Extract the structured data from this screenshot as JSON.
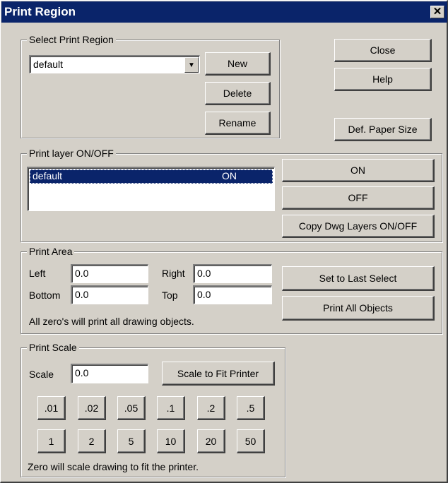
{
  "window": {
    "title": "Print Region",
    "close_glyph": "✕"
  },
  "select_region": {
    "legend": "Select Print Region",
    "selected": "default",
    "new_label": "New",
    "delete_label": "Delete",
    "rename_label": "Rename"
  },
  "side_buttons": {
    "close_label": "Close",
    "help_label": "Help",
    "paper_label": "Def. Paper Size"
  },
  "layers": {
    "legend": "Print layer ON/OFF",
    "rows": [
      {
        "name": "default",
        "state": "ON"
      }
    ],
    "on_label": "ON",
    "off_label": "OFF",
    "copy_label": "Copy Dwg Layers ON/OFF"
  },
  "area": {
    "legend": "Print Area",
    "left_label": "Left",
    "left_value": "0.0",
    "right_label": "Right",
    "right_value": "0.0",
    "bottom_label": "Bottom",
    "bottom_value": "0.0",
    "top_label": "Top",
    "top_value": "0.0",
    "note": "All zero's will print all drawing objects.",
    "set_last_label": "Set to Last Select",
    "print_all_label": "Print All Objects"
  },
  "scale": {
    "legend": "Print Scale",
    "scale_label": "Scale",
    "scale_value": "0.0",
    "fit_label": "Scale to Fit Printer",
    "row1": [
      ".01",
      ".02",
      ".05",
      ".1",
      ".2",
      ".5"
    ],
    "row2": [
      "1",
      "2",
      "5",
      "10",
      "20",
      "50"
    ],
    "note": "Zero will scale drawing to fit the printer."
  },
  "colors": {
    "title_bar": "#0a246a",
    "face": "#d4d0c8",
    "selection": "#0a246a"
  }
}
